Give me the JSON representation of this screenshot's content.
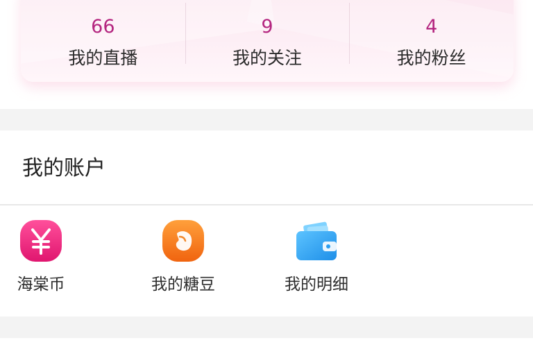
{
  "stats": [
    {
      "value": "66",
      "label": "我的直播"
    },
    {
      "value": "9",
      "label": "我的关注"
    },
    {
      "value": "4",
      "label": "我的粉丝"
    }
  ],
  "account": {
    "title": "我的账户",
    "items": [
      {
        "label": "海棠币",
        "icon": "yen-coin-icon",
        "color": "#e5287a"
      },
      {
        "label": "我的糖豆",
        "icon": "bean-icon",
        "color": "#f07c16"
      },
      {
        "label": "我的明细",
        "icon": "wallet-icon",
        "color": "#2aa0f2"
      }
    ]
  },
  "colors": {
    "accent": "#b4257f",
    "card_bg": "#fbe7f0",
    "divider_band": "#f3f3f3"
  }
}
